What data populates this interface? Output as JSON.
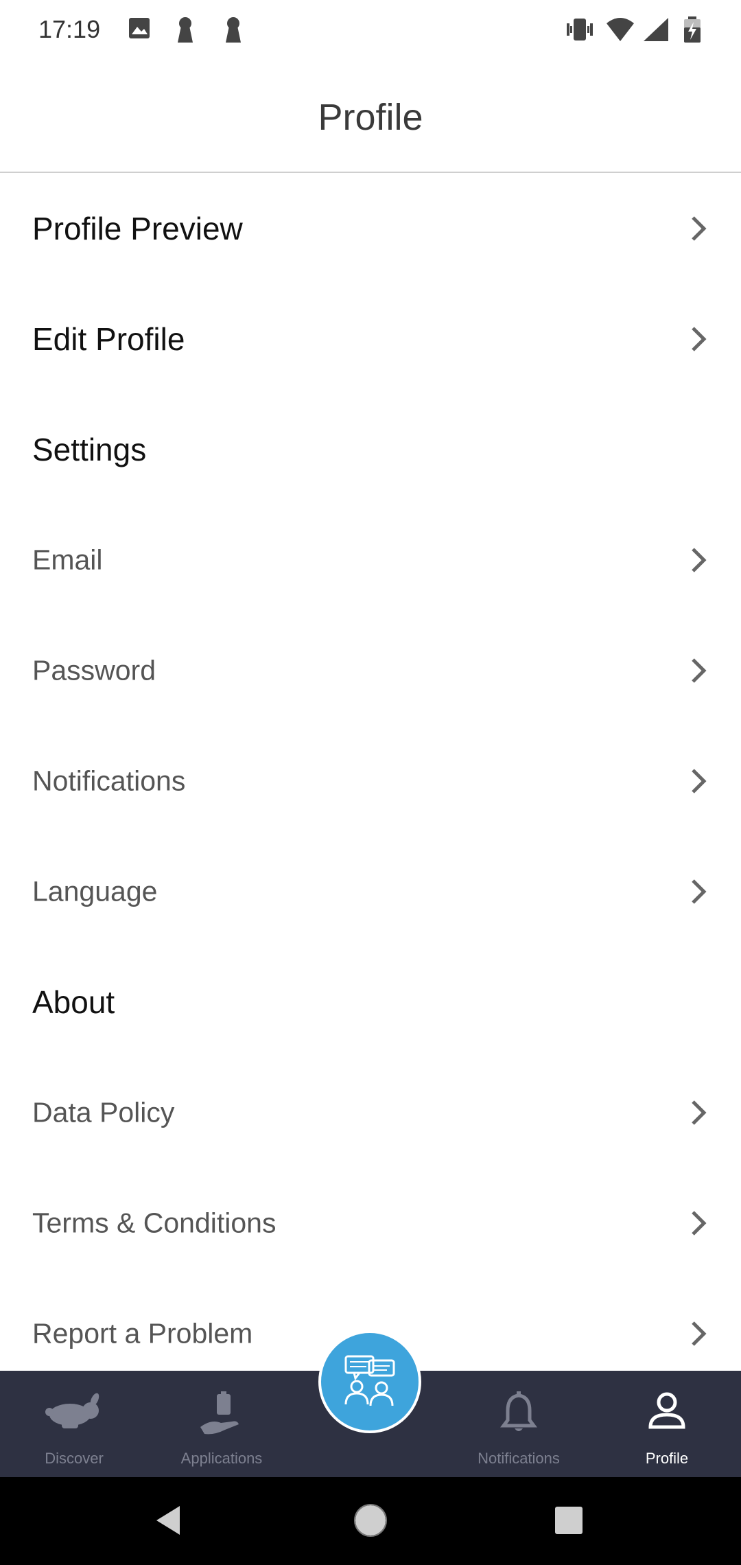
{
  "status_bar": {
    "time": "17:19",
    "left_icons": [
      "image-icon",
      "keyhole-icon",
      "keyhole-icon"
    ],
    "right_icons": [
      "vibrate-icon",
      "wifi-icon",
      "signal-icon",
      "battery-charging-icon"
    ]
  },
  "header": {
    "title": "Profile"
  },
  "menu": {
    "profile_preview": "Profile Preview",
    "edit_profile": "Edit Profile",
    "settings_heading": "Settings",
    "email": "Email",
    "password": "Password",
    "notifications": "Notifications",
    "language": "Language",
    "about_heading": "About",
    "data_policy": "Data Policy",
    "terms": "Terms & Conditions",
    "report_problem": "Report a Problem"
  },
  "bottom_nav": {
    "discover": "Discover",
    "applications": "Applications",
    "notifications": "Notifications",
    "profile": "Profile",
    "active": "profile",
    "fab_icon": "community-chat-icon"
  },
  "colors": {
    "nav_background": "#2e3142",
    "fab": "#3ea4dc",
    "inactive": "#7d8090",
    "active": "#ffffff"
  }
}
